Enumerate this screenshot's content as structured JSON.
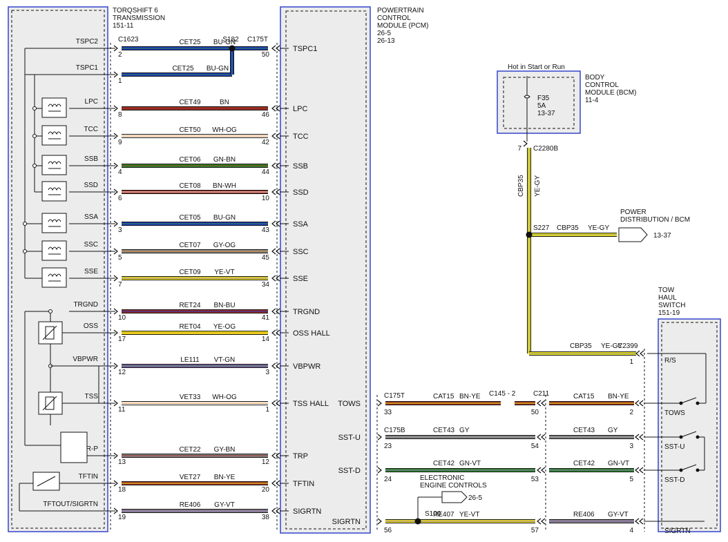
{
  "colors": {
    "BU": "#1e36c8",
    "BN": "#9a2e22",
    "WH": "#ffffff",
    "OG": "#d9822b",
    "GN": "#2b8f2b",
    "YE": "#f0e81a",
    "VT": "#8e62b8",
    "GY": "#8a8a8a",
    "BK": "#111111",
    "PCM_border": "#3344cc"
  },
  "components": {
    "trans": {
      "title": [
        "TORQSHIFT 6",
        "TRANSMISSION",
        "151-11"
      ]
    },
    "pcm": {
      "title": [
        "POWERTRAIN",
        "CONTROL",
        "MODULE (PCM)",
        "26-5",
        "26-13"
      ]
    },
    "bcm": {
      "title": [
        "BODY",
        "CONTROL",
        "MODULE (BCM)",
        "11-4"
      ],
      "hot_label": "Hot in Start or Run",
      "fuse": [
        "F35",
        "5A",
        "13-37"
      ],
      "connector": "C2280B",
      "pin": "7"
    },
    "tow": {
      "title": [
        "TOW",
        "HAUL",
        "SWITCH",
        "151-19"
      ],
      "connector": "C2399",
      "pin": "1"
    }
  },
  "splices": {
    "s182": "S182",
    "s227": "S227",
    "s100": "S100"
  },
  "connectors": {
    "c1623": "C1623",
    "c175t": "C175T",
    "c175t_tows": "C175T",
    "c175b": "C175B",
    "c145": "C145 - 2",
    "c211": "C211"
  },
  "left_wires": [
    {
      "pin": "TSPC2",
      "tpin": "2",
      "circuit": "CET25",
      "color": "BU-GN",
      "pcm": "TSPC1",
      "ppin": "50"
    },
    {
      "pin": "TSPC1",
      "tpin": "1",
      "circuit": "CET25",
      "color": "BU-GN",
      "pcm": "",
      "ppin": ""
    },
    {
      "pin": "LPC",
      "tpin": "8",
      "circuit": "CET49",
      "color": "BN",
      "pcm": "LPC",
      "ppin": "46"
    },
    {
      "pin": "TCC",
      "tpin": "9",
      "circuit": "CET50",
      "color": "WH-OG",
      "pcm": "TCC",
      "ppin": "42"
    },
    {
      "pin": "SSB",
      "tpin": "4",
      "circuit": "CET06",
      "color": "GN-BN",
      "pcm": "SSB",
      "ppin": "44"
    },
    {
      "pin": "SSD",
      "tpin": "6",
      "circuit": "CET08",
      "color": "BN-WH",
      "pcm": "SSD",
      "ppin": "10"
    },
    {
      "pin": "SSA",
      "tpin": "3",
      "circuit": "CET05",
      "color": "BU-GN",
      "pcm": "SSA",
      "ppin": "43"
    },
    {
      "pin": "SSC",
      "tpin": "5",
      "circuit": "CET07",
      "color": "GY-OG",
      "pcm": "SSC",
      "ppin": "45"
    },
    {
      "pin": "SSE",
      "tpin": "7",
      "circuit": "CET09",
      "color": "YE-VT",
      "pcm": "SSE",
      "ppin": "34"
    },
    {
      "pin": "TRGND",
      "tpin": "10",
      "circuit": "RET24",
      "color": "BN-BU",
      "pcm": "TRGND",
      "ppin": "41"
    },
    {
      "pin": "OSS",
      "tpin": "17",
      "circuit": "RET04",
      "color": "YE-OG",
      "pcm": "OSS HALL",
      "ppin": "14"
    },
    {
      "pin": "VBPWR",
      "tpin": "12",
      "circuit": "LE111",
      "color": "VT-GN",
      "pcm": "VBPWR",
      "ppin": "3"
    },
    {
      "pin": "TSS",
      "tpin": "11",
      "circuit": "VET33",
      "color": "WH-OG",
      "pcm": "TSS HALL",
      "ppin": "1"
    },
    {
      "pin": "TRS/TR-P",
      "tpin": "13",
      "circuit": "CET22",
      "color": "GY-BN",
      "pcm": "TRP",
      "ppin": "12"
    },
    {
      "pin": "TFTIN",
      "tpin": "18",
      "circuit": "VET27",
      "color": "BN-YE",
      "pcm": "TFTIN",
      "ppin": "20"
    },
    {
      "pin": "TFTOUT/SIGRTN",
      "tpin": "19",
      "circuit": "RE406",
      "color": "GY-VT",
      "pcm": "SIGRTN",
      "ppin": "38"
    }
  ],
  "right_wires": [
    {
      "pcm": "TOWS",
      "ppin": "33",
      "c1": "CAT15",
      "col1": "BN-YE",
      "mpin": "50",
      "c2": "CAT15",
      "col2": "BN-YE",
      "spin": "2",
      "sw": "TOWS"
    },
    {
      "pcm": "SST-U",
      "ppin": "23",
      "c1": "CET43",
      "col1": "GY",
      "mpin": "54",
      "c2": "CET43",
      "col2": "GY",
      "spin": "3",
      "sw": "SST-U"
    },
    {
      "pcm": "SST-D",
      "ppin": "24",
      "c1": "CET42",
      "col1": "GN-VT",
      "mpin": "53",
      "c2": "CET42",
      "col2": "GN-VT",
      "spin": "5",
      "sw": "SST-D"
    },
    {
      "pcm": "SIGRTN",
      "ppin": "56",
      "c1": "RE407",
      "col1": "YE-VT",
      "mpin": "57",
      "c2": "RE406",
      "col2": "GY-VT",
      "spin": "4",
      "sw": "SIGRTN"
    }
  ],
  "switch_rs": "R/S",
  "cbp": {
    "circuit": "CBP35",
    "color": "YE-GY"
  },
  "power_dist": {
    "title": [
      "POWER",
      "DISTRIBUTION / BCM"
    ],
    "ref": "13-37"
  },
  "eec": {
    "title": [
      "ELECTRONIC",
      "ENGINE CONTROLS"
    ],
    "ref": "26-5"
  }
}
